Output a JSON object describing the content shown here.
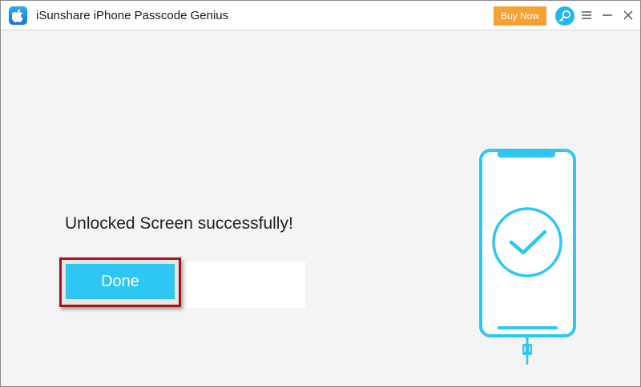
{
  "window": {
    "title": "iSunshare iPhone Passcode Genius",
    "buy_now_label": "Buy Now",
    "icons": {
      "app": "apple-logo-icon",
      "register": "key-search-icon",
      "menu": "hamburger-menu-icon",
      "minimize": "minimize-icon",
      "close": "close-icon"
    }
  },
  "main": {
    "status_message": "Unlocked Screen successfully!",
    "done_label": "Done",
    "illustration": {
      "device": "phone-icon",
      "status": "checkmark-circle-icon",
      "cable": "usb-cable-icon"
    }
  },
  "colors": {
    "accent": "#2ec6f2",
    "buy_now": "#f5a134",
    "highlight_border": "#a2161b",
    "background": "#f4f4f4"
  }
}
